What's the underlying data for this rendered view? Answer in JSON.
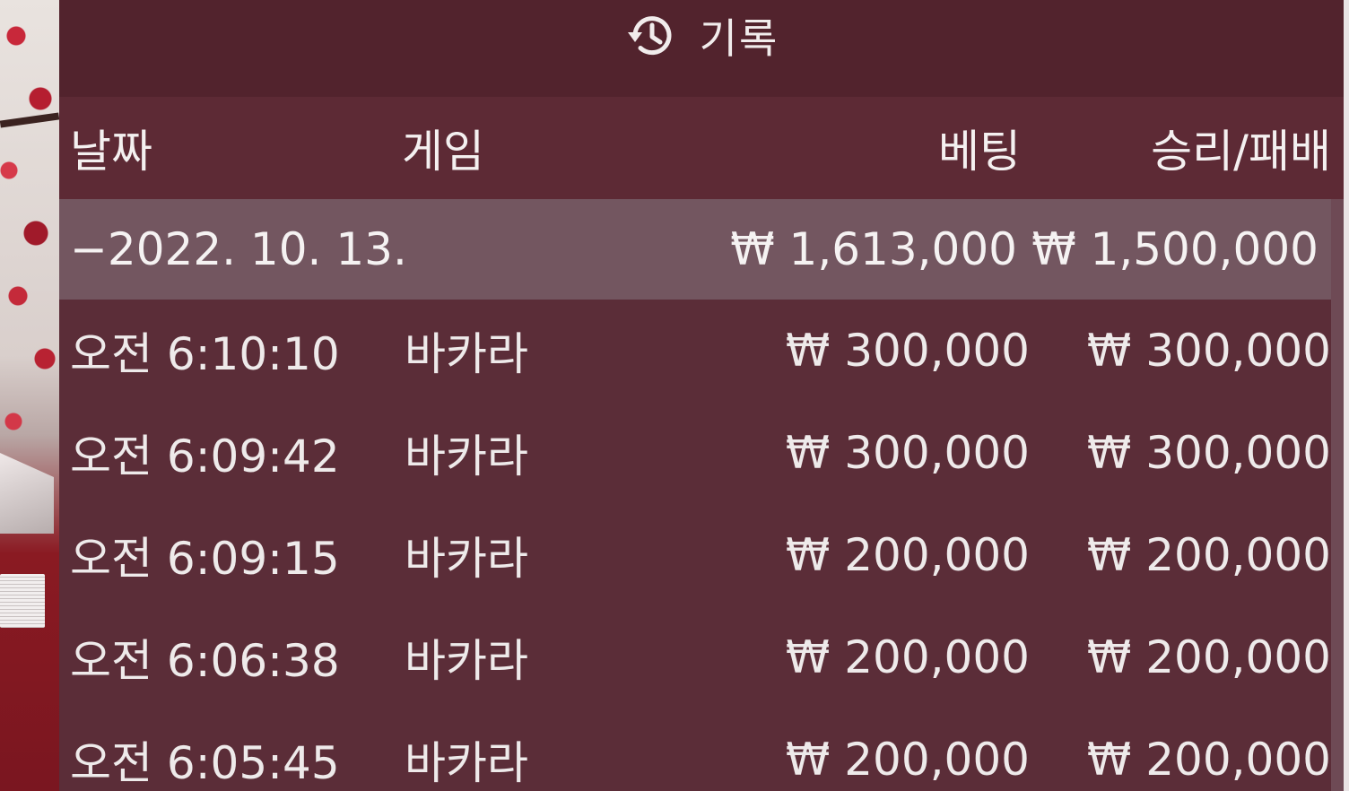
{
  "header": {
    "icon": "history-icon",
    "title": "기록"
  },
  "columns": {
    "date": "날짜",
    "game": "게임",
    "bet": "베팅",
    "result": "승리/패배"
  },
  "group": {
    "date": "−2022. 10. 13.",
    "bet_total": "₩ 1,613,000",
    "result_total": "₩ 1,500,000"
  },
  "rows": [
    {
      "time": "오전 6:10:10",
      "game": "바카라",
      "bet": "₩ 300,000",
      "result": "₩ 300,000"
    },
    {
      "time": "오전 6:09:42",
      "game": "바카라",
      "bet": "₩ 300,000",
      "result": "₩ 300,000"
    },
    {
      "time": "오전 6:09:15",
      "game": "바카라",
      "bet": "₩ 200,000",
      "result": "₩ 200,000"
    },
    {
      "time": "오전 6:06:38",
      "game": "바카라",
      "bet": "₩ 200,000",
      "result": "₩ 200,000"
    },
    {
      "time": "오전 6:05:45",
      "game": "바카라",
      "bet": "₩ 200,000",
      "result": "₩ 200,000"
    }
  ]
}
